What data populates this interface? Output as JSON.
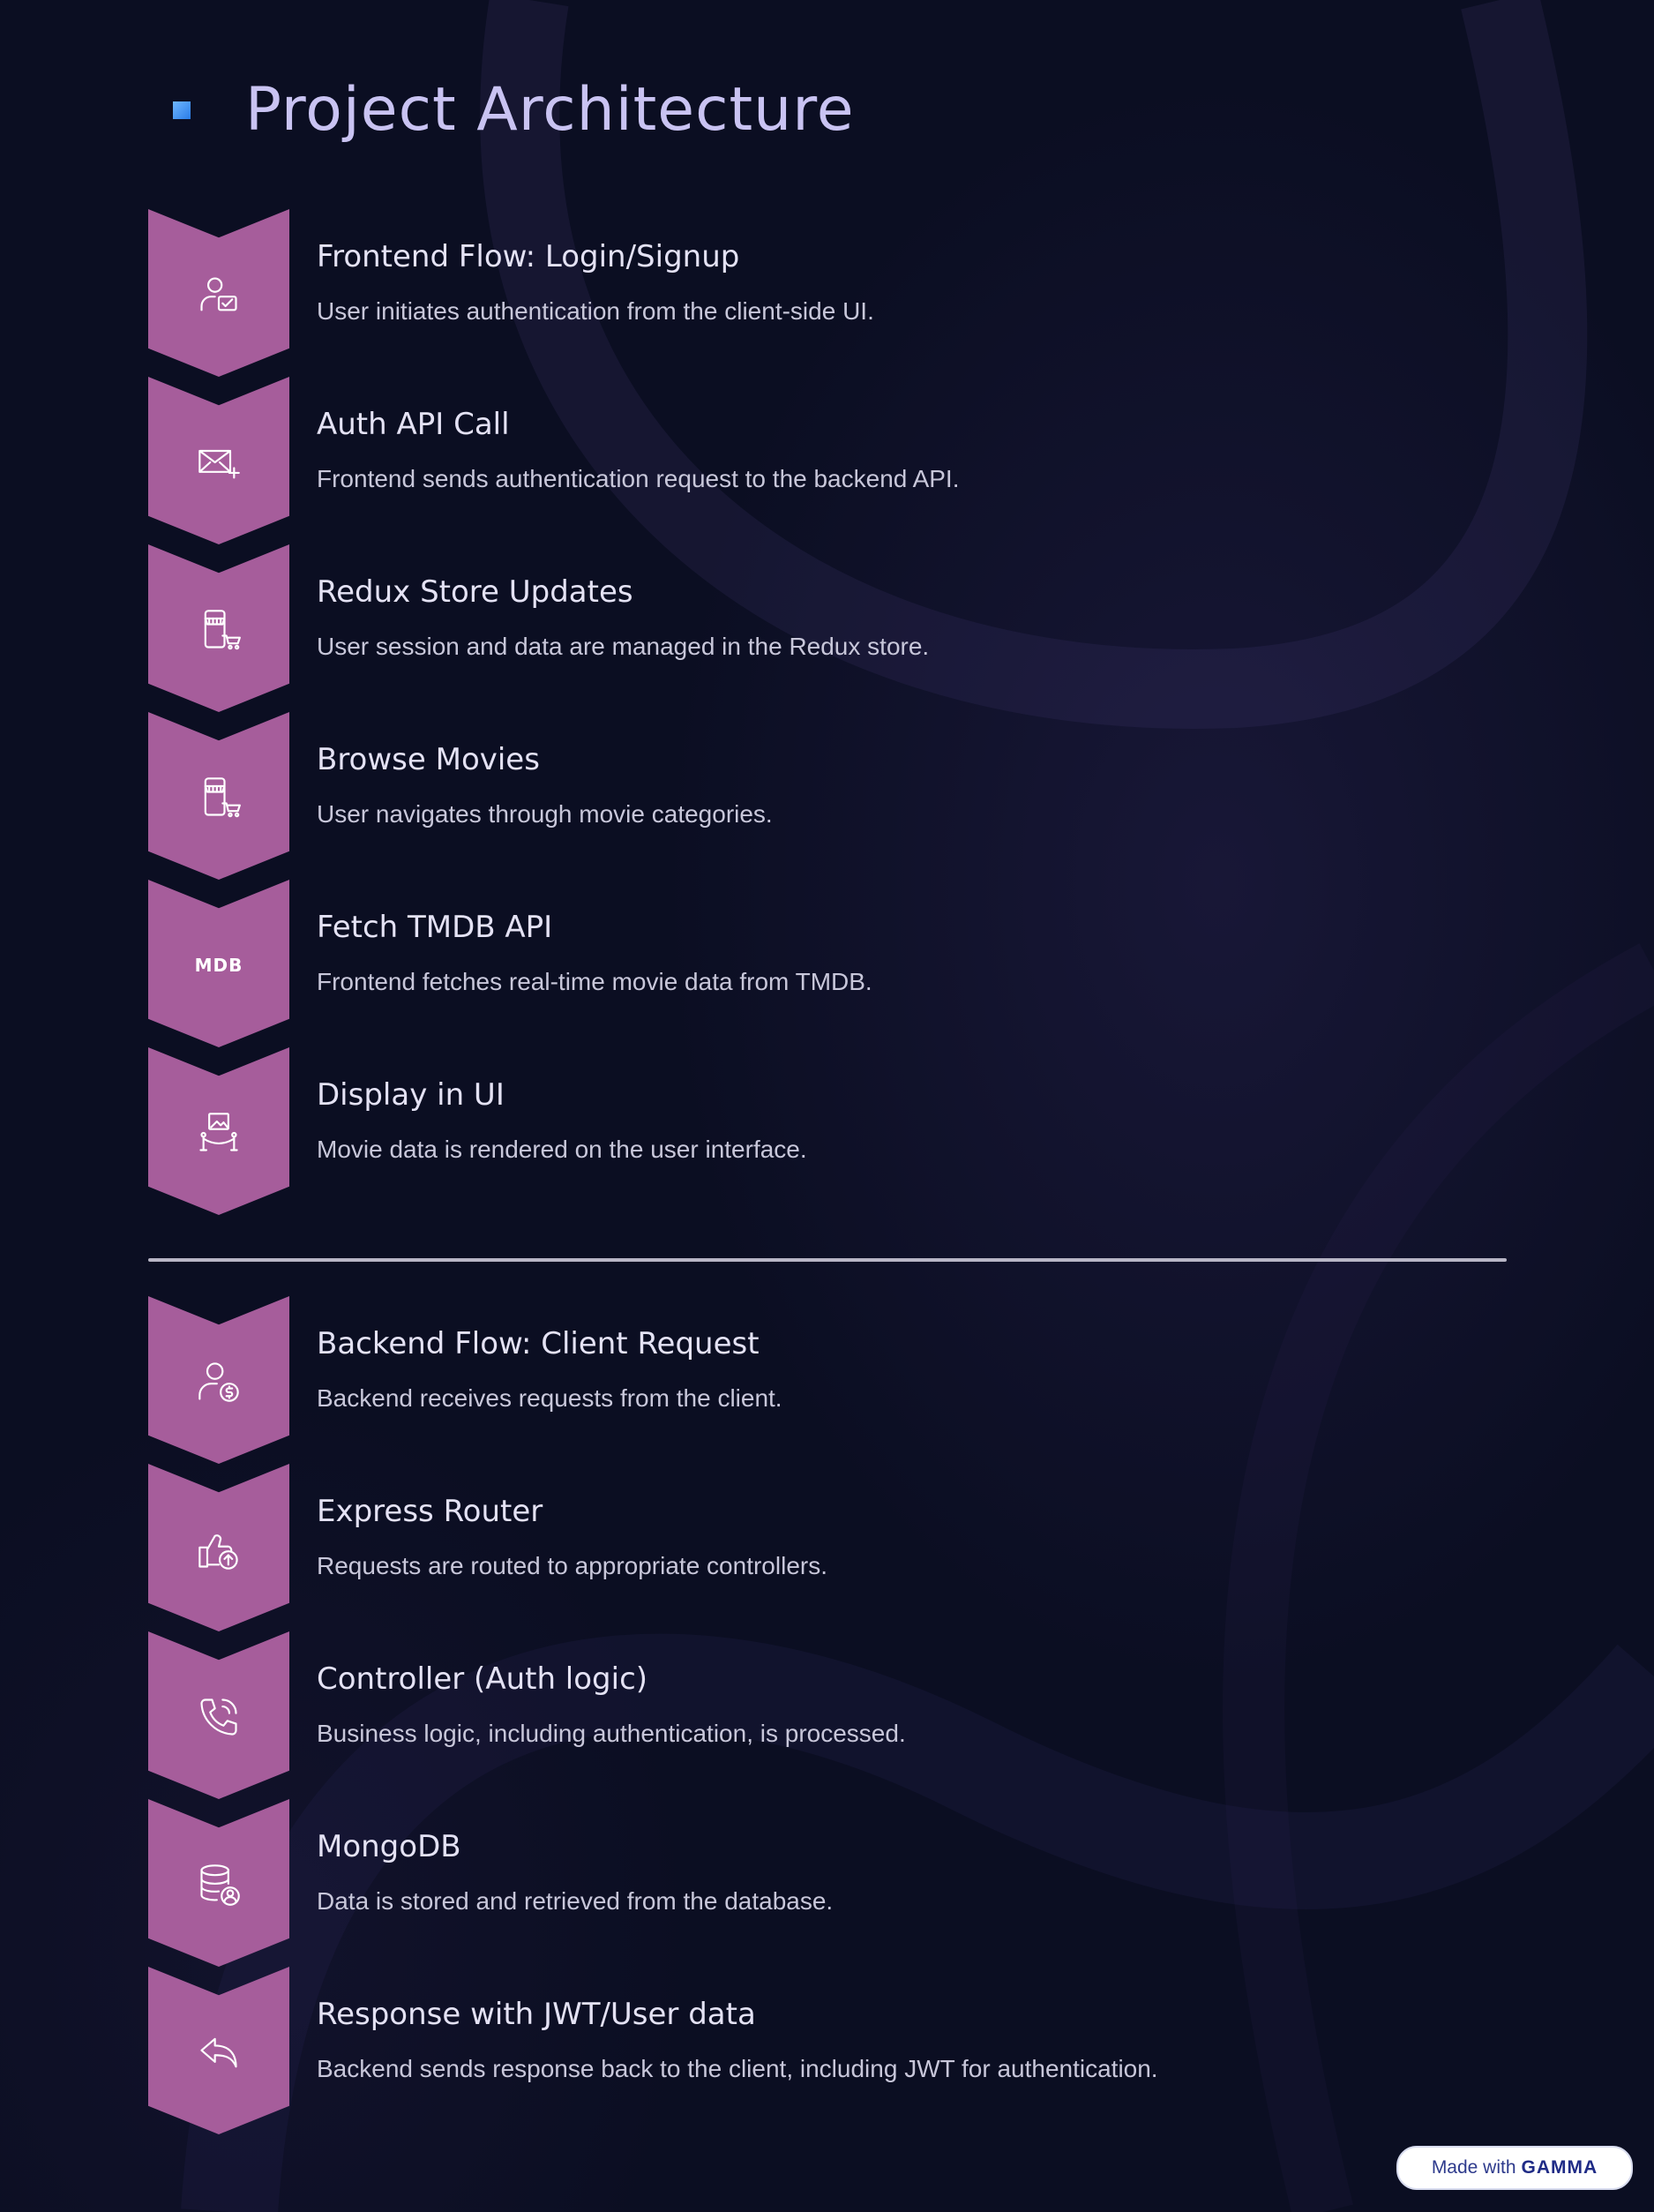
{
  "page": {
    "title": "Project Architecture",
    "accent_color": "#a65d9b",
    "background_color": "#0b0e22"
  },
  "frontend": {
    "steps": [
      {
        "title": "Frontend Flow: Login/Signup",
        "desc": "User initiates authentication from the client-side UI.",
        "icon": "user-check-icon"
      },
      {
        "title": "Auth API Call",
        "desc": "Frontend sends authentication request to the backend API.",
        "icon": "mail-add-icon"
      },
      {
        "title": "Redux Store Updates",
        "desc": "User session and data are managed in the Redux store.",
        "icon": "mobile-shop-icon"
      },
      {
        "title": "Browse Movies",
        "desc": "User navigates through movie categories.",
        "icon": "mobile-shop-icon"
      },
      {
        "title": "Fetch TMDB API",
        "desc": "Frontend fetches real-time movie data from TMDB.",
        "icon": "tmdb-logo",
        "icon_text": "MDB"
      },
      {
        "title": "Display in UI",
        "desc": "Movie data is rendered on the user interface.",
        "icon": "gallery-exhibit-icon"
      }
    ]
  },
  "backend": {
    "steps": [
      {
        "title": "Backend Flow: Client Request",
        "desc": "Backend receives requests from the client.",
        "icon": "user-dollar-icon"
      },
      {
        "title": "Express Router",
        "desc": "Requests are routed to appropriate controllers.",
        "icon": "thumbs-up-upload-icon"
      },
      {
        "title": "Controller (Auth logic)",
        "desc": "Business logic, including authentication, is processed.",
        "icon": "phone-call-icon"
      },
      {
        "title": "MongoDB",
        "desc": "Data is stored and retrieved from the database.",
        "icon": "database-user-icon"
      },
      {
        "title": "Response with JWT/User data",
        "desc": "Backend sends response back to the client, including JWT for authentication.",
        "icon": "reply-arrow-icon"
      }
    ]
  },
  "badge": {
    "prefix": "Made with",
    "brand": "GAMMA"
  }
}
